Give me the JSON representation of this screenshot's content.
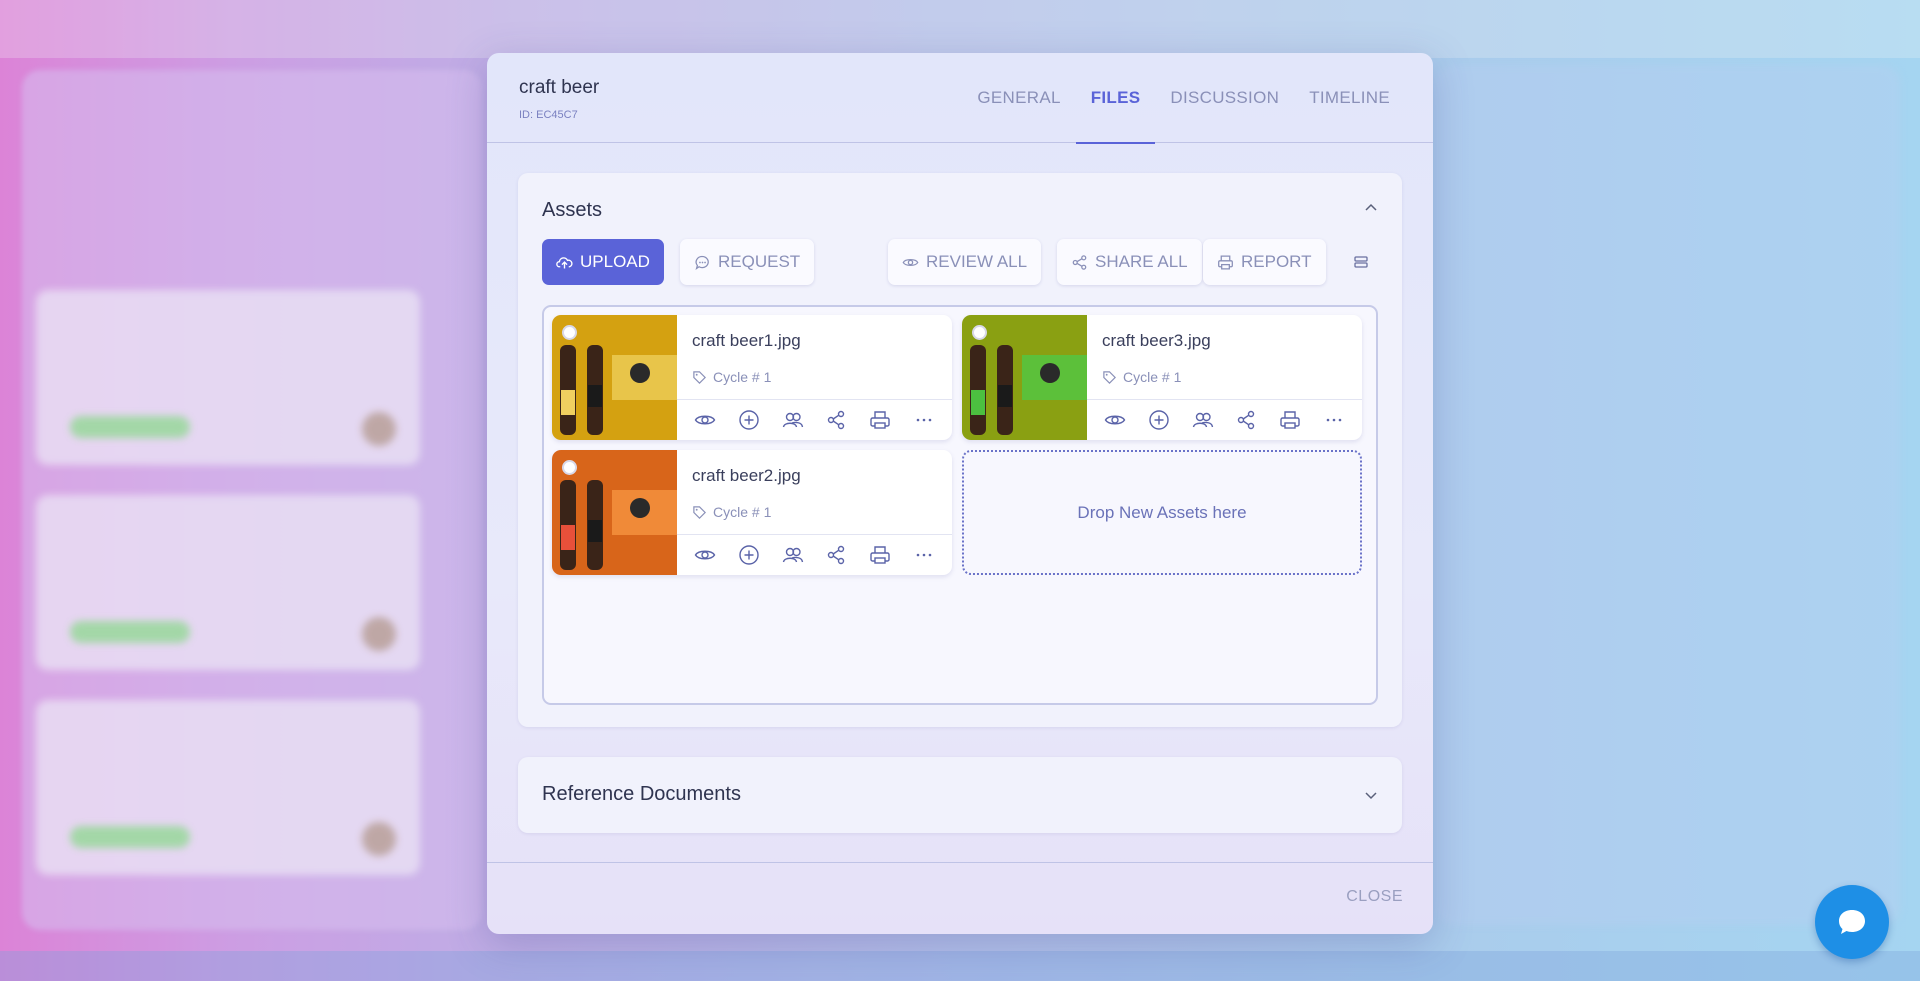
{
  "modal": {
    "title": "craft beer",
    "id_label": "ID: EC45C7",
    "tabs": [
      {
        "label": "GENERAL",
        "active": false
      },
      {
        "label": "FILES",
        "active": true
      },
      {
        "label": "DISCUSSION",
        "active": false
      },
      {
        "label": "TIMELINE",
        "active": false
      }
    ],
    "close_label": "CLOSE"
  },
  "assets": {
    "title": "Assets",
    "buttons": {
      "upload": "UPLOAD",
      "request": "REQUEST",
      "review_all": "REVIEW ALL",
      "share_all": "SHARE ALL",
      "report": "REPORT"
    },
    "files": [
      {
        "name": "craft beer1.jpg",
        "tag": "Cycle # 1",
        "thumb_color": "#d4a111"
      },
      {
        "name": "craft beer3.jpg",
        "tag": "Cycle # 1",
        "thumb_color": "#8aa012"
      },
      {
        "name": "craft beer2.jpg",
        "tag": "Cycle # 1",
        "thumb_color": "#d8651a"
      }
    ],
    "drop_label": "Drop New Assets here"
  },
  "reference_documents": {
    "title": "Reference Documents"
  },
  "colors": {
    "accent": "#5a63d8",
    "chat": "#1e8fe6"
  },
  "icons": [
    "upload-cloud-icon",
    "chat-bubble-icon",
    "eye-icon",
    "share-icon",
    "printer-icon",
    "list-icon",
    "tag-icon",
    "plus-circle-icon",
    "users-icon",
    "more-icon",
    "chevron-up-icon",
    "chevron-down-icon"
  ]
}
